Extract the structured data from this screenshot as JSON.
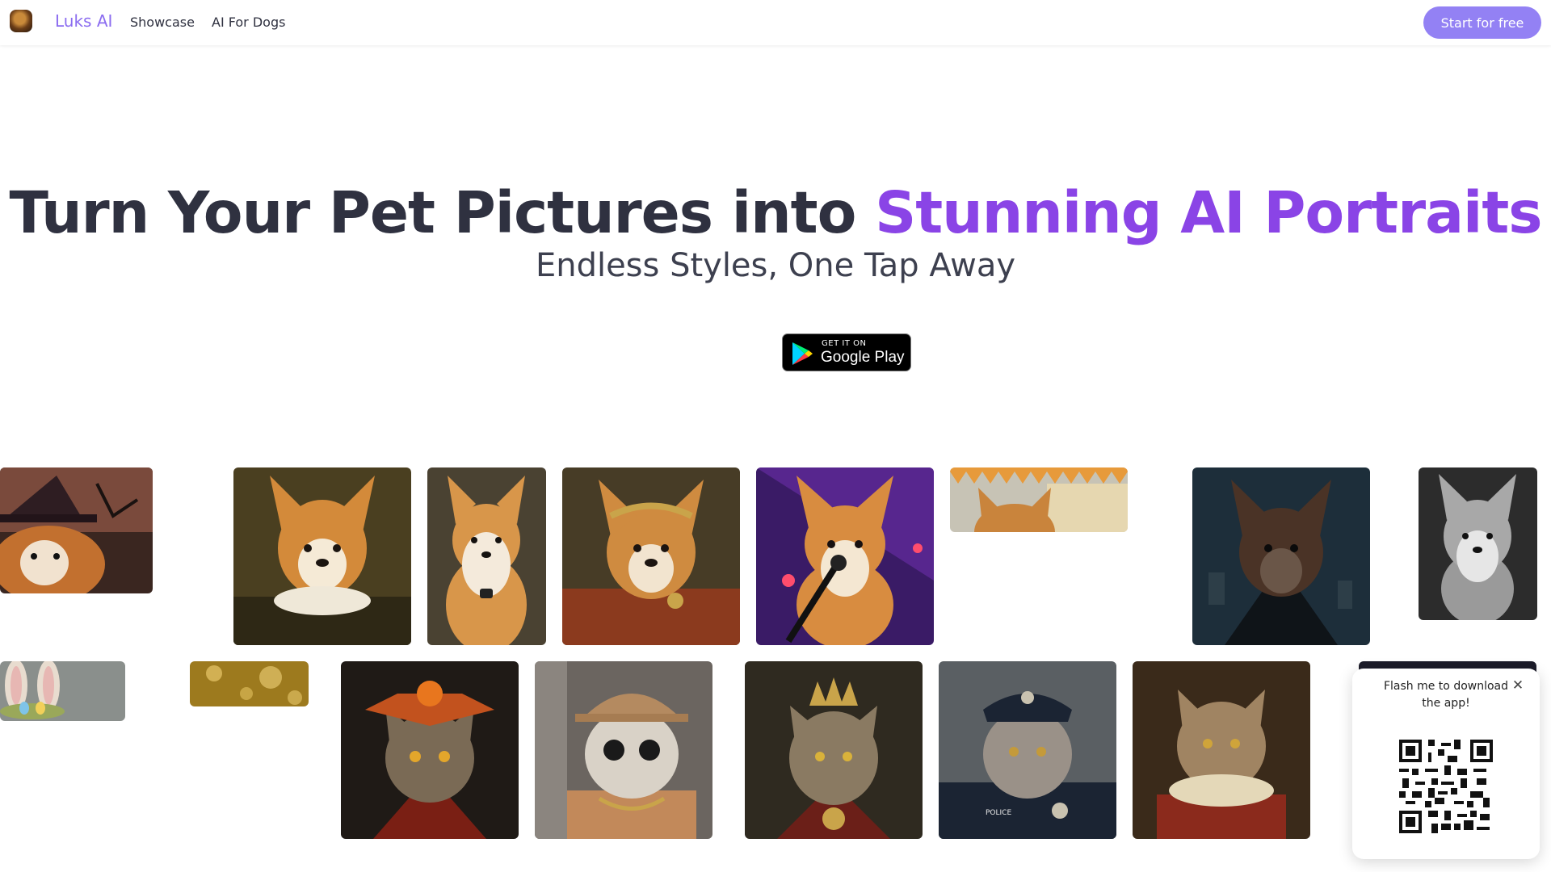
{
  "nav": {
    "brand": "Luks AI",
    "links": [
      "Showcase",
      "AI For Dogs"
    ],
    "cta": "Start for free"
  },
  "hero": {
    "title_main": "Turn Your Pet Pictures into ",
    "title_highlight": "Stunning AI Portraits",
    "subtitle": "Endless Styles, One Tap Away",
    "store_badge": {
      "small": "GET IT ON",
      "big": "Google Play"
    }
  },
  "gallery": {
    "row1": [
      "corgi-witch-hat",
      "corgi-ruff-collar-portrait",
      "corgi-sitting-portrait",
      "corgi-roman-laurel",
      "corgi-singer-microphone",
      "corgi-festival",
      "corgi-vampire-night",
      "corgi-black-and-white"
    ],
    "row2": [
      "bunny-ears-easter",
      "cat-bokeh-garden",
      "cat-halloween-pumpkin-hat",
      "cat-bucket-hat-sunglasses",
      "cat-king-crown",
      "cat-police-officer",
      "cat-ruff-collar-portrait"
    ],
    "police_badge_text": "POLICE"
  },
  "popup": {
    "text": "Flash me to download the app!",
    "close_icon": "close-icon"
  },
  "colors": {
    "brand": "#8b6cf0",
    "highlight": "#8a44e6",
    "cta": "#9381f4"
  }
}
